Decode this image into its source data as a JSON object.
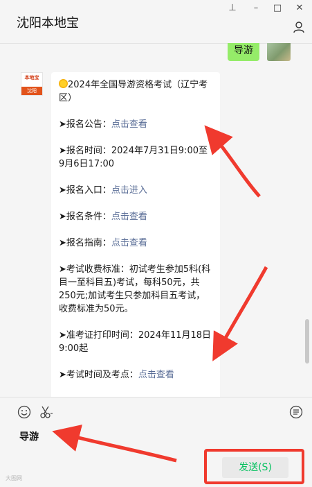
{
  "window": {
    "title": "沈阳本地宝",
    "controls": {
      "pin": "⊥",
      "minimize": "–",
      "maximize": "□",
      "close": "✕"
    }
  },
  "chat": {
    "sent_message": "导游",
    "bot_avatar": {
      "logo_text": "本地宝",
      "logo_bar": "沈阳"
    },
    "reply": {
      "title": "2024年全国导游资格考试（辽宁考区）",
      "items": [
        {
          "label": "➤报名公告：",
          "link": "点击查看"
        },
        {
          "label": "➤报名时间：2024年7月31日9:00至9月6日17:00"
        },
        {
          "label": "➤报名入口：",
          "link": "点击进入"
        },
        {
          "label": "➤报名条件：",
          "link": "点击查看"
        },
        {
          "label": "➤报名指南：",
          "link": "点击查看"
        },
        {
          "label": "➤考试收费标准：初试考生参加5科(科目一至科目五)考试，每科50元，共250元;加试考生只参加科目五考试，收费标准为50元。"
        },
        {
          "label": "➤准考证打印时间：2024年11月18日9:00起"
        },
        {
          "label": "➤考试时间及考点：",
          "link": "点击查看"
        }
      ]
    }
  },
  "input": {
    "text": "导游",
    "send_button": "发送(S)",
    "tools": [
      "emoji-icon",
      "scissors-icon",
      "chat-history-icon"
    ]
  },
  "watermark": "大图网",
  "colors": {
    "bubble_green": "#95ec69",
    "link": "#576b95",
    "send_text": "#07c160",
    "annotation_red": "#f03a2e"
  }
}
